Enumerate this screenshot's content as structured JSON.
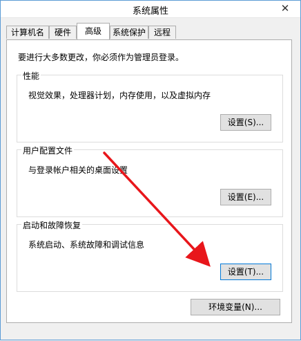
{
  "window": {
    "title": "系统属性",
    "close_glyph": "✕"
  },
  "tabs": [
    {
      "label": "计算机名"
    },
    {
      "label": "硬件"
    },
    {
      "label": "高级",
      "active": true
    },
    {
      "label": "系统保护"
    },
    {
      "label": "远程"
    }
  ],
  "panel": {
    "admin_note": "要进行大多数更改，你必须作为管理员登录。",
    "groups": [
      {
        "title": "性能",
        "description": "视觉效果，处理器计划，内存使用，以及虚拟内存",
        "button": "设置(S)..."
      },
      {
        "title": "用户配置文件",
        "description": "与登录帐户相关的桌面设置",
        "button": "设置(E)..."
      },
      {
        "title": "启动和故障恢复",
        "description": "系统启动、系统故障和调试信息",
        "button": "设置(T)..."
      }
    ],
    "env_button": "环境变量(N)..."
  },
  "annotation": {
    "arrow_color": "#e8161b"
  }
}
